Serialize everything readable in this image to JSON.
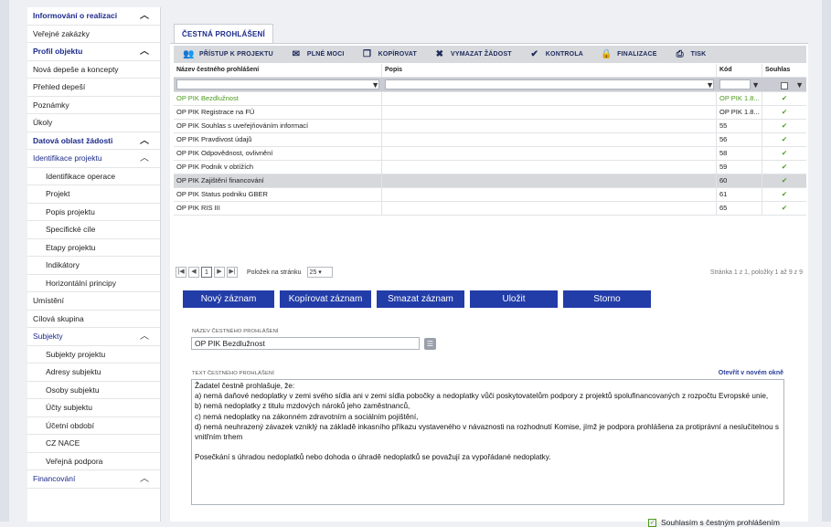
{
  "sidebar": {
    "items": [
      {
        "label": "Informování o realizaci",
        "kind": "header",
        "caret": "^"
      },
      {
        "label": "Veřejné zakázky",
        "kind": "plain"
      },
      {
        "label": "Profil objektu",
        "kind": "header",
        "caret": "^"
      },
      {
        "label": "Nová depeše a koncepty",
        "kind": "plain"
      },
      {
        "label": "Přehled depeší",
        "kind": "plain"
      },
      {
        "label": "Poznámky",
        "kind": "plain"
      },
      {
        "label": "Úkoly",
        "kind": "plain"
      },
      {
        "label": "Datová oblast žádosti",
        "kind": "header",
        "caret": "^"
      },
      {
        "label": "Identifikace projektu",
        "kind": "section",
        "caret": "^"
      },
      {
        "label": "Identifikace operace",
        "kind": "sub"
      },
      {
        "label": "Projekt",
        "kind": "sub"
      },
      {
        "label": "Popis projektu",
        "kind": "sub"
      },
      {
        "label": "Specifické cíle",
        "kind": "sub"
      },
      {
        "label": "Etapy projektu",
        "kind": "sub"
      },
      {
        "label": "Indikátory",
        "kind": "sub"
      },
      {
        "label": "Horizontální principy",
        "kind": "sub"
      },
      {
        "label": "Umístění",
        "kind": "plain"
      },
      {
        "label": "Cílová skupina",
        "kind": "plain"
      },
      {
        "label": "Subjekty",
        "kind": "section",
        "caret": "^"
      },
      {
        "label": "Subjekty projektu",
        "kind": "sub"
      },
      {
        "label": "Adresy subjektu",
        "kind": "sub"
      },
      {
        "label": "Osoby subjektu",
        "kind": "sub"
      },
      {
        "label": "Účty subjektu",
        "kind": "sub"
      },
      {
        "label": "Účetní období",
        "kind": "sub"
      },
      {
        "label": "CZ NACE",
        "kind": "sub"
      },
      {
        "label": "Veřejná podpora",
        "kind": "sub"
      },
      {
        "label": "Financování",
        "kind": "section",
        "caret": "^"
      }
    ]
  },
  "tab": {
    "label": "ČESTNÁ PROHLÁŠENÍ"
  },
  "toolbar": {
    "buttons": [
      {
        "icon": "users-icon",
        "glyph": "👥",
        "label": "PŘÍSTUP K PROJEKTU"
      },
      {
        "icon": "mail-icon",
        "glyph": "✉",
        "label": "PLNÉ MOCI"
      },
      {
        "icon": "copy-icon",
        "glyph": "❐",
        "label": "KOPÍROVAT"
      },
      {
        "icon": "delete-icon",
        "glyph": "✖",
        "label": "VYMAZAT ŽÁDOST"
      },
      {
        "icon": "check-icon",
        "glyph": "✔",
        "label": "KONTROLA"
      },
      {
        "icon": "lock-icon",
        "glyph": "🔒",
        "label": "FINALIZACE"
      },
      {
        "icon": "print-icon",
        "glyph": "⎙",
        "label": "TISK"
      }
    ]
  },
  "grid": {
    "headers": [
      "Název čestného prohlášení",
      "Popis",
      "Kód",
      "Souhlas"
    ],
    "rows": [
      {
        "name": "OP PIK Bezdlužnost",
        "desc": "",
        "code": "OP PIK 1.8...",
        "agree": "✔"
      },
      {
        "name": "OP PIK Registrace na FÚ",
        "desc": "",
        "code": "OP PIK 1.8...",
        "agree": "✔"
      },
      {
        "name": "OP PIK Souhlas s uveřejňováním informací",
        "desc": "",
        "code": "55",
        "agree": "✔"
      },
      {
        "name": "OP PIK Pravdivost údajů",
        "desc": "",
        "code": "56",
        "agree": "✔"
      },
      {
        "name": "OP PIK Odpovědnost, ovlivnění",
        "desc": "",
        "code": "58",
        "agree": "✔"
      },
      {
        "name": "OP PIK Podnik v obtížích",
        "desc": "",
        "code": "59",
        "agree": "✔"
      },
      {
        "name": "OP PIK Zajištění financování",
        "desc": "",
        "code": "60",
        "agree": "✔"
      },
      {
        "name": "OP PIK Status podniku GBER",
        "desc": "",
        "code": "61",
        "agree": "✔"
      },
      {
        "name": "OP PIK RIS III",
        "desc": "",
        "code": "65",
        "agree": "✔"
      }
    ],
    "selected_row": 6
  },
  "pager": {
    "current_page": "1",
    "page_size_label": "Položek na stránku",
    "page_size": "25",
    "info": "Stránka 1 z 1, položky 1 až 9 z 9"
  },
  "actions": {
    "new": "Nový záznam",
    "copy": "Kopírovat záznam",
    "delete": "Smazat záznam",
    "save": "Uložit",
    "cancel": "Storno"
  },
  "form": {
    "name_label": "NÁZEV ČESTNÉHO PROHLÁŠENÍ",
    "name_value": "OP PIK Bezdlužnost",
    "text_label": "TEXT ČESTNÉHO PROHLÁŠENÍ",
    "open_link": "Otevřít v novém okně",
    "text_lines": [
      "Žadatel čestně prohlašuje, že:",
      "a) nemá daňové nedoplatky v zemi svého sídla ani v zemi sídla pobočky a nedoplatky vůči poskytovatelům podpory z projektů spolufinancovaných z rozpočtu Evropské unie,",
      "b) nemá nedoplatky z titulu mzdových nároků jeho zaměstnanců,",
      "c) nemá nedoplatky na zákonném zdravotním a sociálním pojištění,",
      "d) nemá neuhrazený závazek vzniklý na základě inkasního příkazu vystaveného v návaznosti na rozhodnutí Komise, jímž je podpora prohlášena za protiprávní a neslučitelnou s",
      "vnitřním trhem",
      "",
      "Posečkání s úhradou nedoplatků nebo dohoda o úhradě nedoplatků se považují za vypořádané nedoplatky."
    ],
    "agree_label": "Souhlasím s čestným prohlášením"
  }
}
